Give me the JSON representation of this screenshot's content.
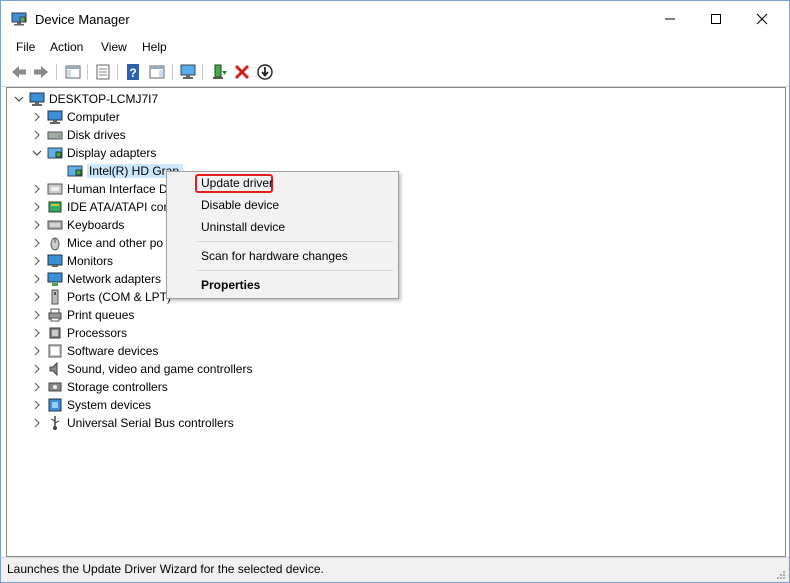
{
  "window": {
    "title": "Device Manager",
    "controls": {
      "minimize": "minimize-icon",
      "maximize": "maximize-icon",
      "close": "close-icon"
    }
  },
  "menubar": {
    "items": [
      "File",
      "Action",
      "View",
      "Help"
    ]
  },
  "toolbar": {
    "buttons": [
      "back-icon",
      "forward-icon",
      "console-tree-icon",
      "properties-icon",
      "help-icon",
      "action-pane-icon",
      "monitor-icon",
      "update-driver-icon",
      "uninstall-icon",
      "enable-device-icon"
    ]
  },
  "tree": {
    "root": "DESKTOP-LCMJ7I7",
    "categories": [
      {
        "label": "Computer",
        "icon": "computer-icon"
      },
      {
        "label": "Disk drives",
        "icon": "disk-drive-icon"
      },
      {
        "label": "Display adapters",
        "icon": "display-adapter-icon",
        "expanded": true
      },
      {
        "label": "Human Interface D",
        "icon": "hid-icon"
      },
      {
        "label": "IDE ATA/ATAPI cor",
        "icon": "ide-icon"
      },
      {
        "label": "Keyboards",
        "icon": "keyboard-icon"
      },
      {
        "label": "Mice and other po",
        "icon": "mouse-icon"
      },
      {
        "label": "Monitors",
        "icon": "monitor-icon"
      },
      {
        "label": "Network adapters",
        "icon": "network-icon"
      },
      {
        "label": "Ports (COM & LPT)",
        "icon": "port-icon"
      },
      {
        "label": "Print queues",
        "icon": "printer-icon"
      },
      {
        "label": "Processors",
        "icon": "processor-icon"
      },
      {
        "label": "Software devices",
        "icon": "software-device-icon"
      },
      {
        "label": "Sound, video and game controllers",
        "icon": "speaker-icon"
      },
      {
        "label": "Storage controllers",
        "icon": "storage-icon"
      },
      {
        "label": "System devices",
        "icon": "system-device-icon"
      },
      {
        "label": "Universal Serial Bus controllers",
        "icon": "usb-icon"
      }
    ],
    "selected_child": "Intel(R) HD Grap"
  },
  "context_menu": {
    "update_driver": "Update driver",
    "disable_device": "Disable device",
    "uninstall_device": "Uninstall device",
    "scan": "Scan for hardware changes",
    "properties": "Properties"
  },
  "statusbar": {
    "text": "Launches the Update Driver Wizard for the selected device."
  },
  "colors": {
    "highlight": "#e41e1e",
    "selection": "#cce8ff"
  }
}
